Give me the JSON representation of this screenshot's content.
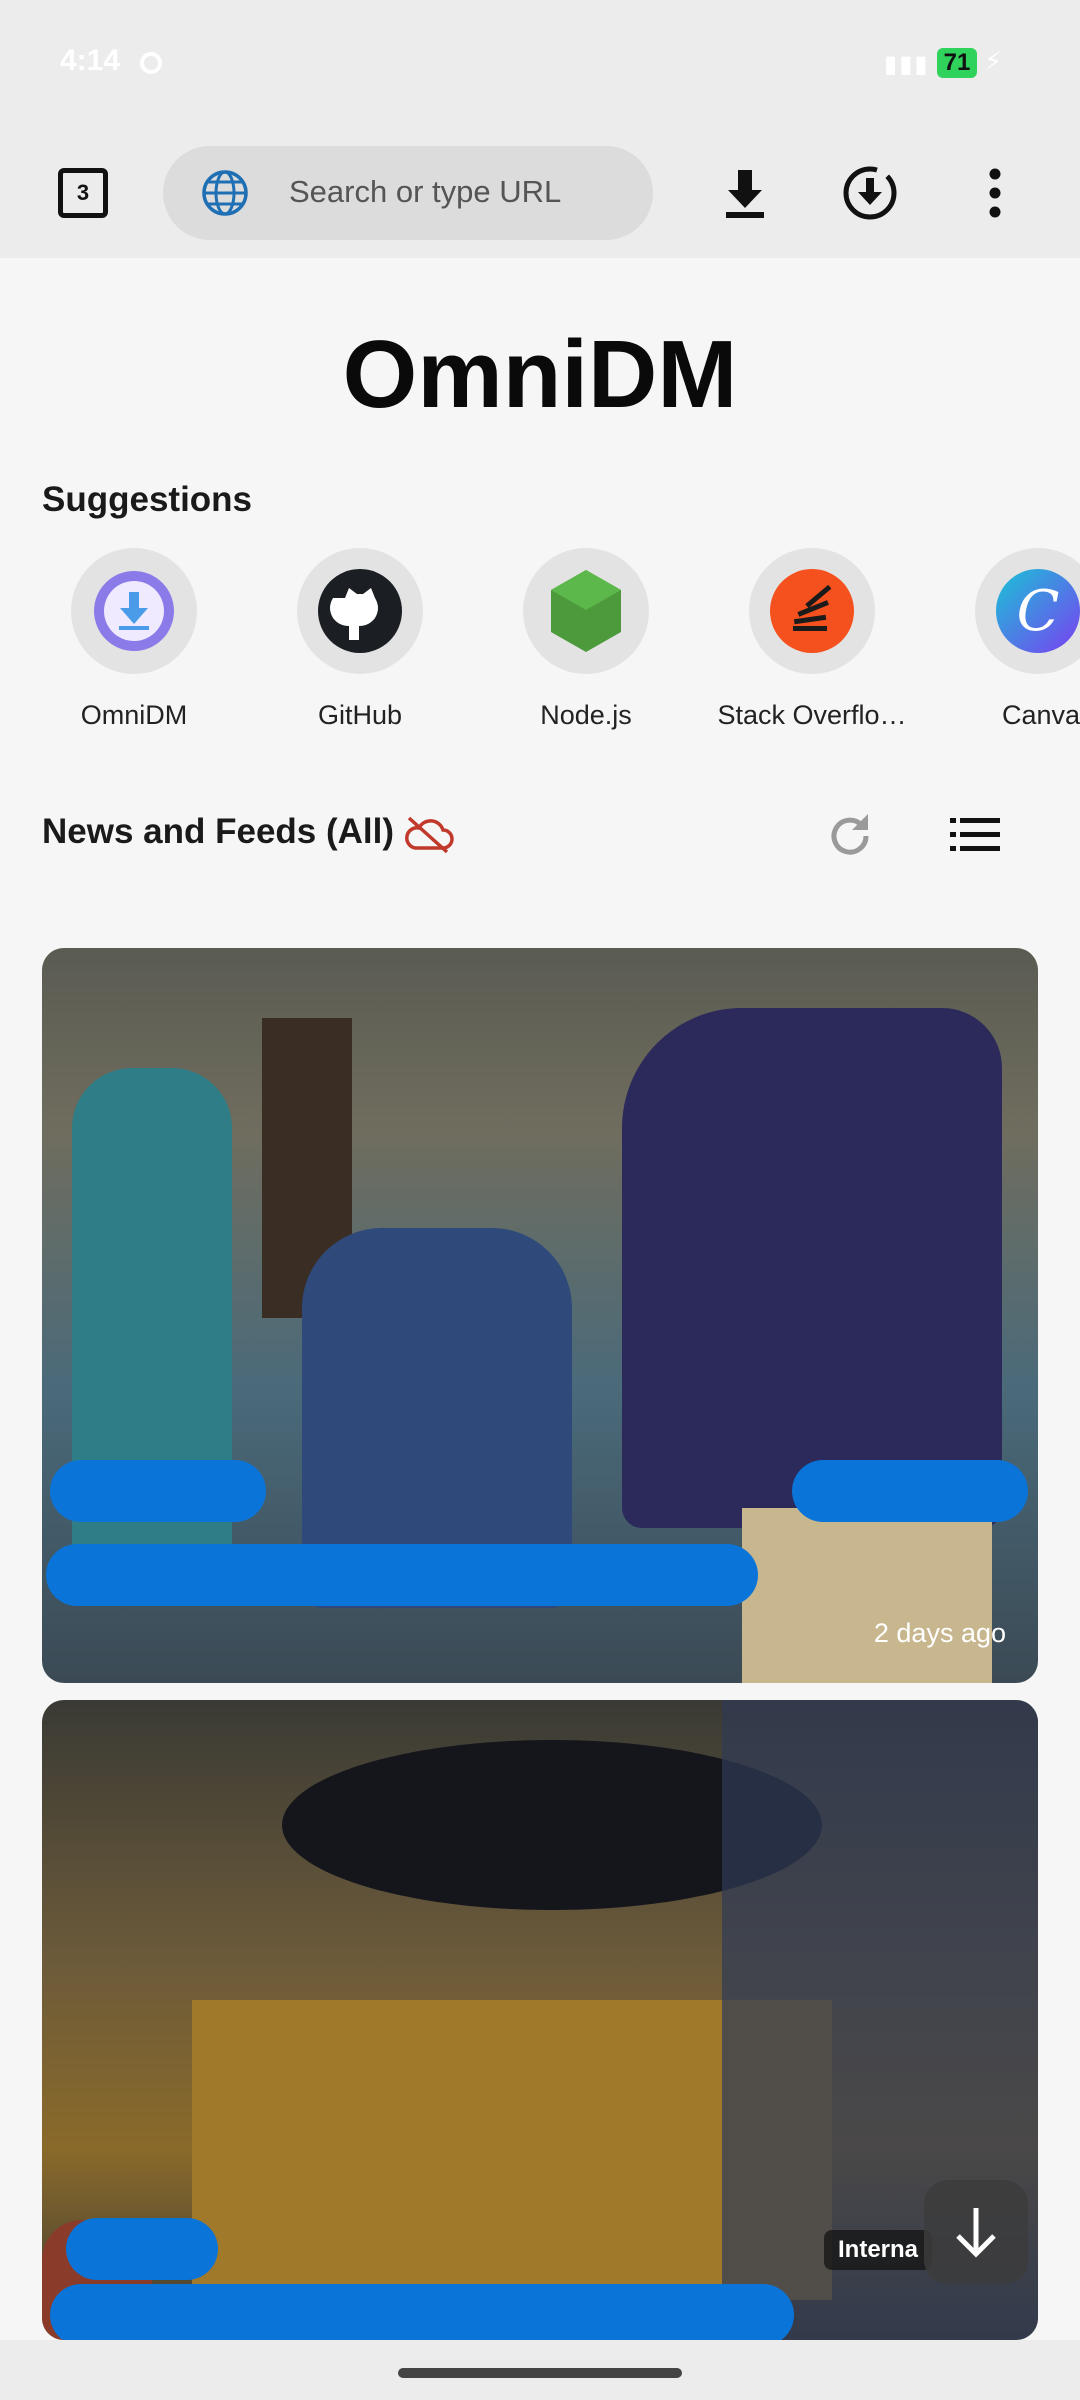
{
  "status_bar": {
    "time": "4:14",
    "battery": "71"
  },
  "toolbar": {
    "tab_count": "3",
    "url_placeholder": "Search or type URL"
  },
  "app_title": "OmniDM",
  "suggestions": {
    "title": "Suggestions",
    "items": [
      {
        "label": "OmniDM",
        "icon": "omnidm-icon"
      },
      {
        "label": "GitHub",
        "icon": "github-icon"
      },
      {
        "label": "Node.js",
        "icon": "nodejs-icon"
      },
      {
        "label": "Stack Overflo…",
        "icon": "stackoverflow-icon"
      },
      {
        "label": "Canva",
        "icon": "canva-icon"
      }
    ]
  },
  "news": {
    "title": "News and Feeds (All)",
    "cards": [
      {
        "time": "2 days ago"
      },
      {
        "category": "Interna"
      }
    ]
  },
  "colors": {
    "redaction": "#0a74d9",
    "cloud_off": "#c0392b",
    "accent_green": "#2fd25a"
  }
}
